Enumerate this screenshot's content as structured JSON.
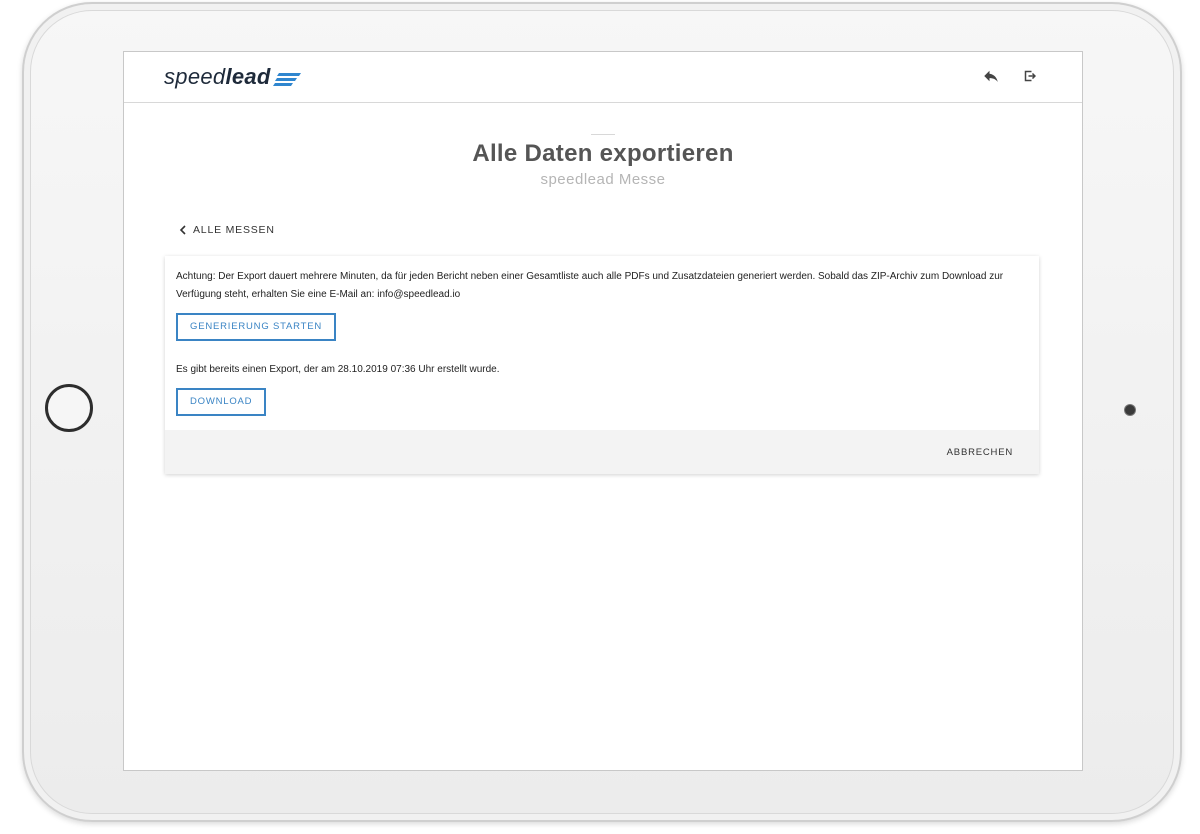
{
  "brand": {
    "logo_part1": "speed",
    "logo_part2": "lead",
    "accent_color": "#2f86cf",
    "text_color": "#1e2a3a"
  },
  "header": {
    "back_icon": "reply-arrow-icon",
    "logout_icon": "logout-icon"
  },
  "page": {
    "title": "Alle Daten exportieren",
    "subtitle": "speedlead Messe",
    "back_label": "ALLE MESSEN"
  },
  "export_card": {
    "notice": "Achtung: Der Export dauert mehrere Minuten, da für jeden Bericht neben einer Gesamtliste auch alle PDFs und Zusatzdateien generiert werden. Sobald das ZIP-Archiv zum Download zur Verfügung steht, erhalten Sie eine E-Mail an: info@speedlead.io",
    "start_button": "GENERIERUNG STARTEN",
    "existing_export": "Es gibt bereits einen Export, der am 28.10.2019 07:36 Uhr erstellt wurde.",
    "download_button": "DOWNLOAD",
    "cancel_button": "ABBRECHEN",
    "button_color": "#3a84c4"
  }
}
